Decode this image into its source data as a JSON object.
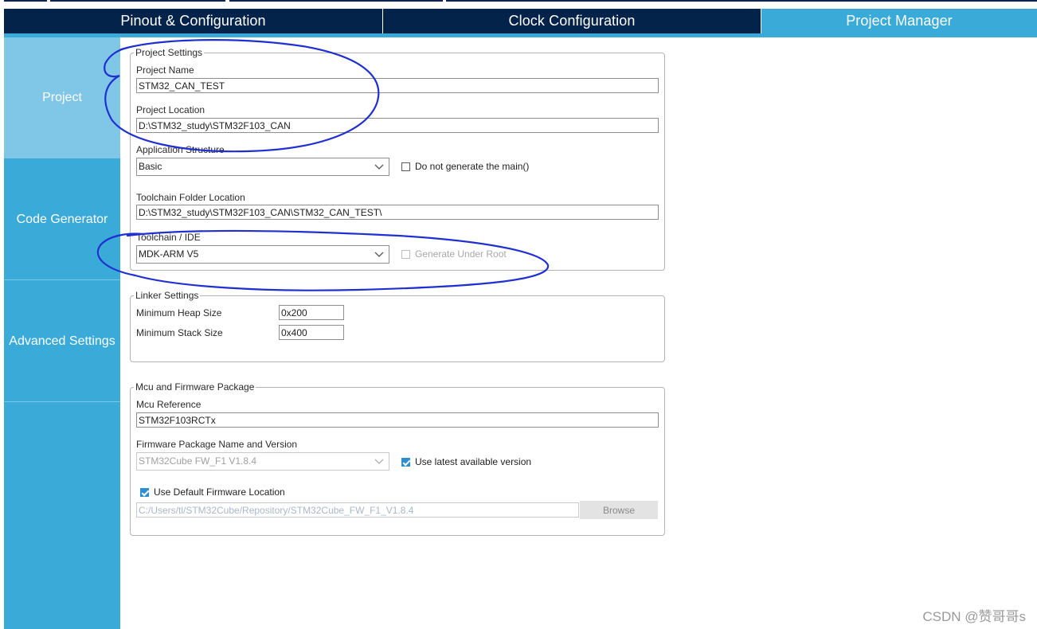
{
  "tabs": [
    {
      "label": "Pinout & Configuration"
    },
    {
      "label": "Clock Configuration"
    },
    {
      "label": "Project Manager"
    }
  ],
  "sidenav": {
    "items": [
      {
        "label": "Project"
      },
      {
        "label": "Code Generator"
      },
      {
        "label": "Advanced Settings"
      }
    ]
  },
  "project_settings": {
    "legend": "Project Settings",
    "project_name_label": "Project Name",
    "project_name": "STM32_CAN_TEST",
    "project_location_label": "Project Location",
    "project_location": "D:\\STM32_study\\STM32F103_CAN",
    "app_structure_label": "Application Structure",
    "app_structure_value": "Basic",
    "no_main_label": "Do not generate the main()",
    "toolchain_folder_label": "Toolchain Folder Location",
    "toolchain_folder": "D:\\STM32_study\\STM32F103_CAN\\STM32_CAN_TEST\\",
    "toolchain_ide_label": "Toolchain / IDE",
    "toolchain_ide_value": "MDK-ARM V5",
    "generate_under_root_label": "Generate Under Root"
  },
  "linker_settings": {
    "legend": "Linker Settings",
    "heap_label": "Minimum Heap Size",
    "heap_value": "0x200",
    "stack_label": "Minimum Stack Size",
    "stack_value": "0x400"
  },
  "mcu_firmware": {
    "legend": "Mcu and Firmware Package",
    "mcu_ref_label": "Mcu Reference",
    "mcu_ref": "STM32F103RCTx",
    "fw_name_label": "Firmware Package Name and Version",
    "fw_name_value": "STM32Cube FW_F1 V1.8.4",
    "use_latest_label": "Use latest available version",
    "use_default_loc_label": "Use Default Firmware Location",
    "fw_location": "C:/Users/tl/STM32Cube/Repository/STM32Cube_FW_F1_V1.8.4",
    "browse_label": "Browse"
  },
  "watermark": "CSDN @赞哥哥s",
  "colors": {
    "tab_dark": "#03234b",
    "tab_active": "#3aaad9",
    "nav_selected": "#7fc6e7",
    "annotation_ink": "#1f2fd1",
    "checkbox_checked": "#2d8fcf"
  }
}
